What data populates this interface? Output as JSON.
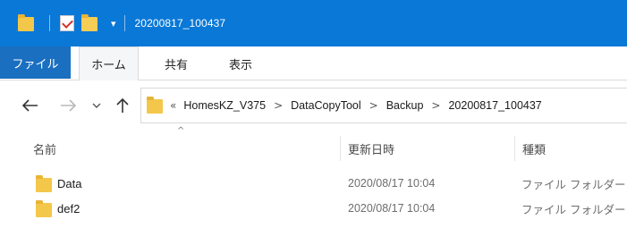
{
  "window": {
    "title": "20200817_100437",
    "accent_color": "#0a78d7"
  },
  "ribbon": {
    "tabs": [
      {
        "label": "ファイル"
      },
      {
        "label": "ホーム"
      },
      {
        "label": "共有"
      },
      {
        "label": "表示"
      }
    ]
  },
  "navigation": {
    "back_icon": "arrow-left-icon",
    "forward_icon": "arrow-right-icon",
    "recent_icon": "chevron-down-icon",
    "up_icon": "arrow-up-icon"
  },
  "address": {
    "overflow": "«",
    "crumbs": [
      "HomesKZ_V375",
      "DataCopyTool",
      "Backup",
      "20200817_100437"
    ],
    "separator": ">"
  },
  "columns": {
    "name": "名前",
    "date": "更新日時",
    "type": "種類"
  },
  "files": [
    {
      "name": "Data",
      "date": "2020/08/17 10:04",
      "type": "ファイル フォルダー"
    },
    {
      "name": "def2",
      "date": "2020/08/17 10:04",
      "type": "ファイル フォルダー"
    }
  ]
}
